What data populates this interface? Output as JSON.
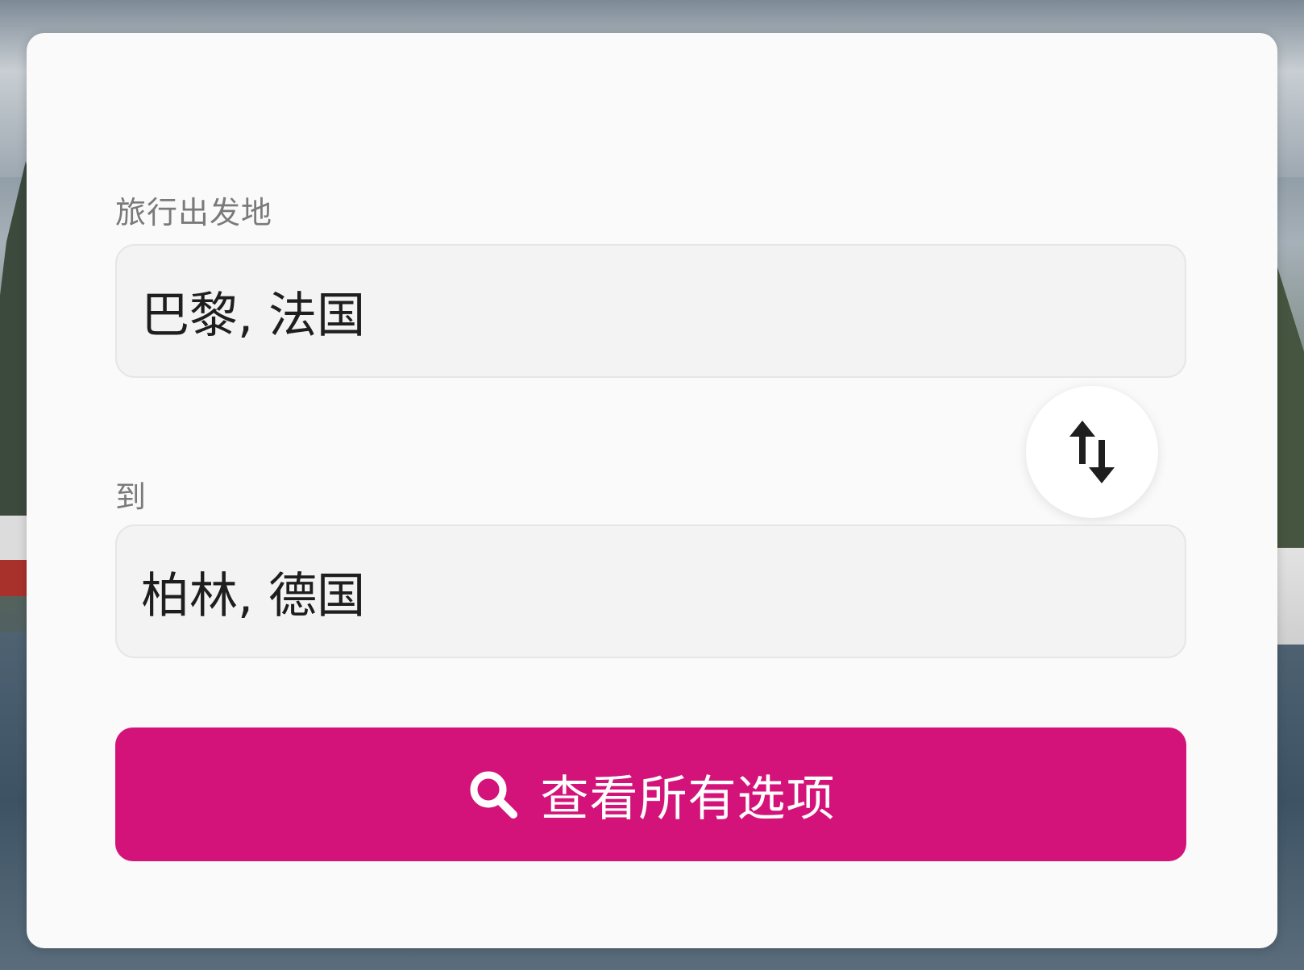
{
  "form": {
    "from_label": "旅行出发地",
    "from_value": "巴黎, 法国",
    "to_label": "到",
    "to_value": "柏林, 德国",
    "search_label": "查看所有选项"
  },
  "icons": {
    "swap": "swap-vertical-arrows-icon",
    "search": "search-icon"
  },
  "colors": {
    "accent": "#d4137a",
    "card_bg": "#fafafa",
    "field_bg": "#f3f3f3",
    "label_text": "#7a7a7a",
    "value_text": "#1e1e1e"
  }
}
